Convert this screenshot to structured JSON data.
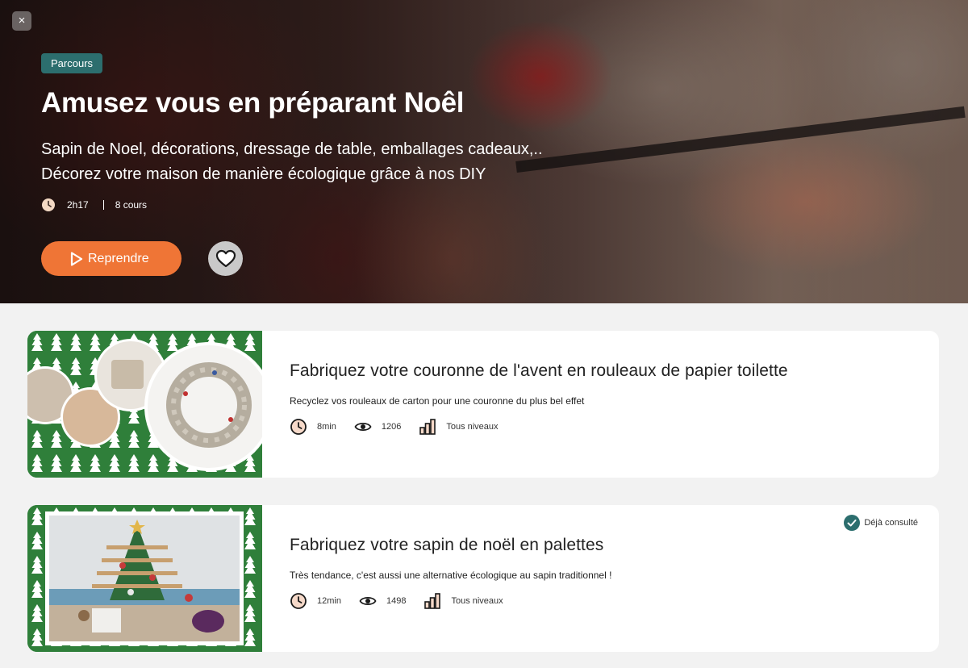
{
  "hero": {
    "tag": "Parcours",
    "title": "Amusez vous en préparant Noêl",
    "subtitle_line1": "Sapin de Noel, décorations, dressage de table, emballages cadeaux,..",
    "subtitle_line2": "Décorez votre maison de manière écologique grâce à nos DIY",
    "duration": "2h17",
    "course_count": "8 cours",
    "resume_label": "Reprendre",
    "close_label": "×"
  },
  "courses": [
    {
      "title": "Fabriquez votre couronne de l'avent en rouleaux de papier toilette",
      "description": "Recyclez vos rouleaux de carton pour une couronne du plus bel effet",
      "duration": "8min",
      "views": "1206",
      "level": "Tous niveaux",
      "seen_label": ""
    },
    {
      "title": "Fabriquez votre sapin de noël en palettes",
      "description": "Très tendance, c'est aussi une alternative écologique au sapin traditionnel !",
      "duration": "12min",
      "views": "1498",
      "level": "Tous niveaux",
      "seen_label": "Déjà consulté"
    }
  ],
  "colors": {
    "accent_orange": "#ef7536",
    "teal": "#2c6e6e",
    "thumb_green": "#2f7f3a"
  },
  "icons": [
    "close-icon",
    "clock-icon",
    "play-icon",
    "heart-icon",
    "eye-icon",
    "level-bars-icon",
    "check-circle-icon"
  ]
}
